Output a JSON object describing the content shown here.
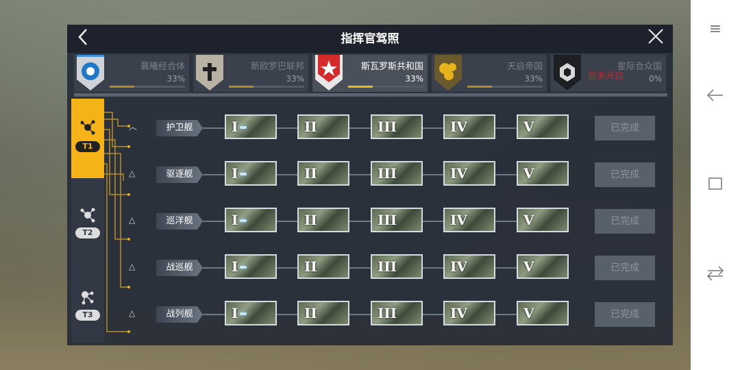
{
  "title": "指挥官驾照",
  "factions": [
    {
      "name": "晨曦经合体",
      "percent": "33%",
      "progress": 0.33,
      "active": false,
      "locked_text": ""
    },
    {
      "name": "新欧罗巴联邦",
      "percent": "33%",
      "progress": 0.33,
      "active": false,
      "locked_text": ""
    },
    {
      "name": "斯瓦罗斯共和国",
      "percent": "33%",
      "progress": 0.33,
      "active": true,
      "locked_text": ""
    },
    {
      "name": "天启帝国",
      "percent": "33%",
      "progress": 0.33,
      "active": false,
      "locked_text": ""
    },
    {
      "name": "星际合众国",
      "percent": "0%",
      "progress": 0.0,
      "active": false,
      "locked_text": "暂未开启"
    }
  ],
  "tiers": [
    {
      "label": "T1",
      "active": true
    },
    {
      "label": "T2",
      "active": false
    },
    {
      "label": "T3",
      "active": false
    }
  ],
  "ship_classes": [
    {
      "name": "护卫舰",
      "status": "已完成"
    },
    {
      "name": "驱逐舰",
      "status": "已完成"
    },
    {
      "name": "巡洋舰",
      "status": "已完成"
    },
    {
      "name": "战巡舰",
      "status": "已完成"
    },
    {
      "name": "战列舰",
      "status": "已完成"
    }
  ],
  "levels": [
    "I",
    "II",
    "III",
    "IV",
    "V"
  ],
  "colors": {
    "accent": "#f4b417",
    "locked": "#c0272d",
    "panel": "#262c38"
  },
  "nav_icons": [
    "menu-icon",
    "back-arrow-icon",
    "recent-apps-icon",
    "switch-icon"
  ]
}
